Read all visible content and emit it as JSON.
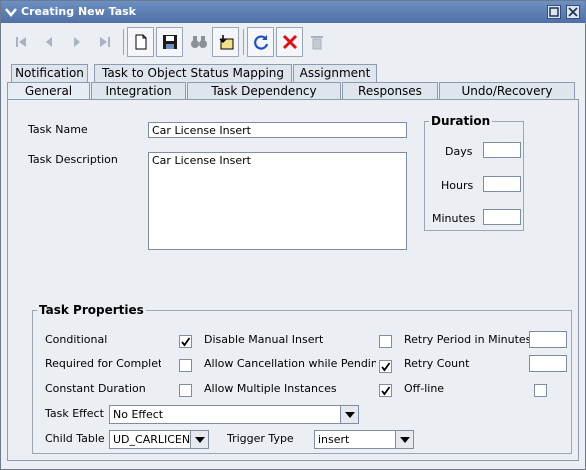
{
  "window": {
    "title": "Creating New Task"
  },
  "tabs_row1": [
    "Notification",
    "Task to Object Status Mapping",
    "Assignment"
  ],
  "tabs_row2": [
    "General",
    "Integration",
    "Task Dependency",
    "Responses",
    "Undo/Recovery"
  ],
  "general": {
    "task_name_label": "Task Name",
    "task_name_value": "Car License Insert",
    "task_desc_label": "Task Description",
    "task_desc_value": "Car License Insert"
  },
  "duration": {
    "legend": "Duration",
    "days_label": "Days",
    "hours_label": "Hours",
    "minutes_label": "Minutes",
    "days_value": "",
    "hours_value": "",
    "minutes_value": ""
  },
  "props": {
    "legend": "Task Properties",
    "conditional": "Conditional",
    "required": "Required for Completion",
    "constant": "Constant Duration",
    "disable_manual": "Disable Manual Insert",
    "allow_cancel": "Allow Cancellation while Pending",
    "allow_multiple": "Allow Multiple Instances",
    "retry_period": "Retry Period in Minutes",
    "retry_count": "Retry Count",
    "offline": "Off-line",
    "retry_period_value": "",
    "retry_count_value": "",
    "task_effect_label": "Task Effect",
    "task_effect_value": "No Effect",
    "child_table_label": "Child Table",
    "child_table_value": "UD_CARLICEN",
    "trigger_type_label": "Trigger Type",
    "trigger_type_value": "insert"
  },
  "colors": {
    "title_bar": "#4e70a6",
    "delete_red": "#e01010",
    "refresh_blue": "#1c4fd0"
  }
}
